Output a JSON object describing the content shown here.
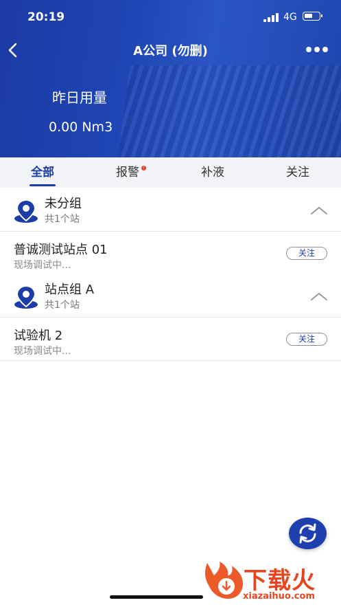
{
  "status_bar": {
    "time": "20:19",
    "network": "4G"
  },
  "nav": {
    "title": "A公司 (勿删)"
  },
  "usage": {
    "label": "昨日用量",
    "value": "0.00 Nm3"
  },
  "tabs": [
    {
      "label": "全部",
      "active": true
    },
    {
      "label": "报警",
      "badge": true
    },
    {
      "label": "补液"
    },
    {
      "label": "关注"
    }
  ],
  "groups": [
    {
      "name": "未分组",
      "count": "共1个站",
      "items": [
        {
          "name": "普诚测试站点 01",
          "status": "现场调试中...",
          "follow_label": "关注"
        }
      ]
    },
    {
      "name": "站点组 A",
      "count": "共1个站",
      "items": [
        {
          "name": "试验机 2",
          "status": "现场调试中...",
          "follow_label": "关注"
        }
      ]
    }
  ],
  "watermark": {
    "brand": "下载火",
    "url": "xiazaihuo.com"
  },
  "colors": {
    "primary": "#1c3da8",
    "badge": "#e0443b",
    "watermark": "#e5451f"
  },
  "icons": [
    "back-icon",
    "more-icon",
    "location-pin-icon",
    "chevron-up-icon",
    "refresh-icon"
  ]
}
